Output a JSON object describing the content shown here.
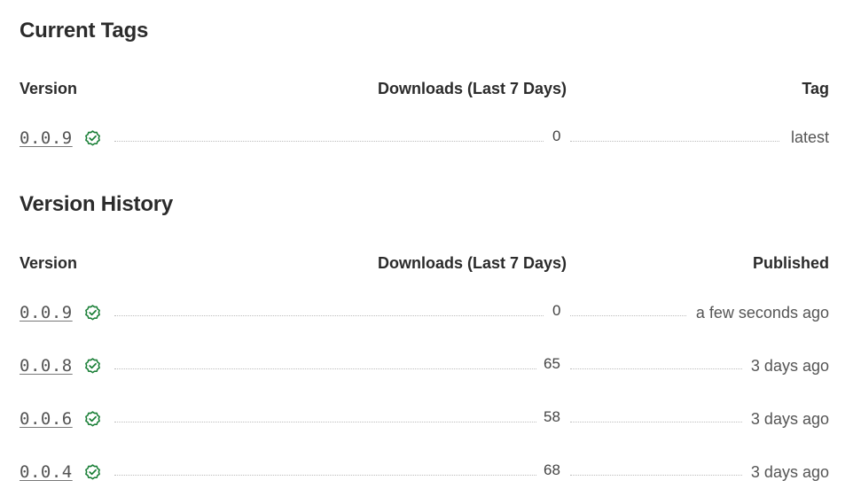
{
  "current_tags": {
    "title": "Current Tags",
    "headers": {
      "version": "Version",
      "downloads": "Downloads (Last 7 Days)",
      "tag": "Tag"
    },
    "rows": [
      {
        "version": "0.0.9",
        "downloads": "0",
        "tag": "latest",
        "icon": "verified-check-icon"
      }
    ]
  },
  "version_history": {
    "title": "Version History",
    "headers": {
      "version": "Version",
      "downloads": "Downloads (Last 7 Days)",
      "published": "Published"
    },
    "rows": [
      {
        "version": "0.0.9",
        "downloads": "0",
        "published": "a few seconds ago",
        "icon": "verified-check-icon"
      },
      {
        "version": "0.0.8",
        "downloads": "65",
        "published": "3 days ago",
        "icon": "verified-check-icon"
      },
      {
        "version": "0.0.6",
        "downloads": "58",
        "published": "3 days ago",
        "icon": "verified-check-icon"
      },
      {
        "version": "0.0.4",
        "downloads": "68",
        "published": "3 days ago",
        "icon": "verified-check-icon"
      }
    ]
  },
  "colors": {
    "check_green": "#1a7f37",
    "heading": "#2b2b2b",
    "text": "#444444",
    "dotted_leader": "#bdbdbd"
  }
}
